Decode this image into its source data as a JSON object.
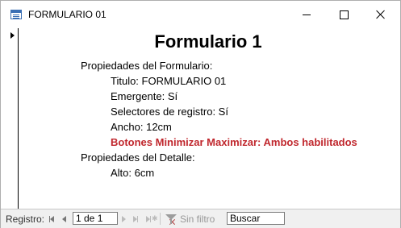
{
  "window": {
    "title": "FORMULARIO 01"
  },
  "form": {
    "heading": "Formulario 1",
    "lines": [
      "Propiedades del Formulario:",
      "Titulo: FORMULARIO 01",
      "Emergente: Sí",
      "Selectores de registro: Sí",
      "Ancho: 12cm",
      "Botones Minimizar Maximizar: Ambos habilitados",
      "Propiedades del Detalle:",
      "Alto: 6cm"
    ]
  },
  "navbar": {
    "label": "Registro:",
    "current": "1 de 1",
    "filter": "Sin filtro",
    "search": "Buscar"
  },
  "colors": {
    "highlight_text": "#c0272d",
    "accent": "#3b6fb4"
  },
  "icons": [
    "form-icon",
    "minimize-icon",
    "maximize-icon",
    "close-icon",
    "record-selector-arrow-icon",
    "first-record-icon",
    "previous-record-icon",
    "next-record-icon",
    "last-record-icon",
    "new-record-icon",
    "filter-icon"
  ]
}
